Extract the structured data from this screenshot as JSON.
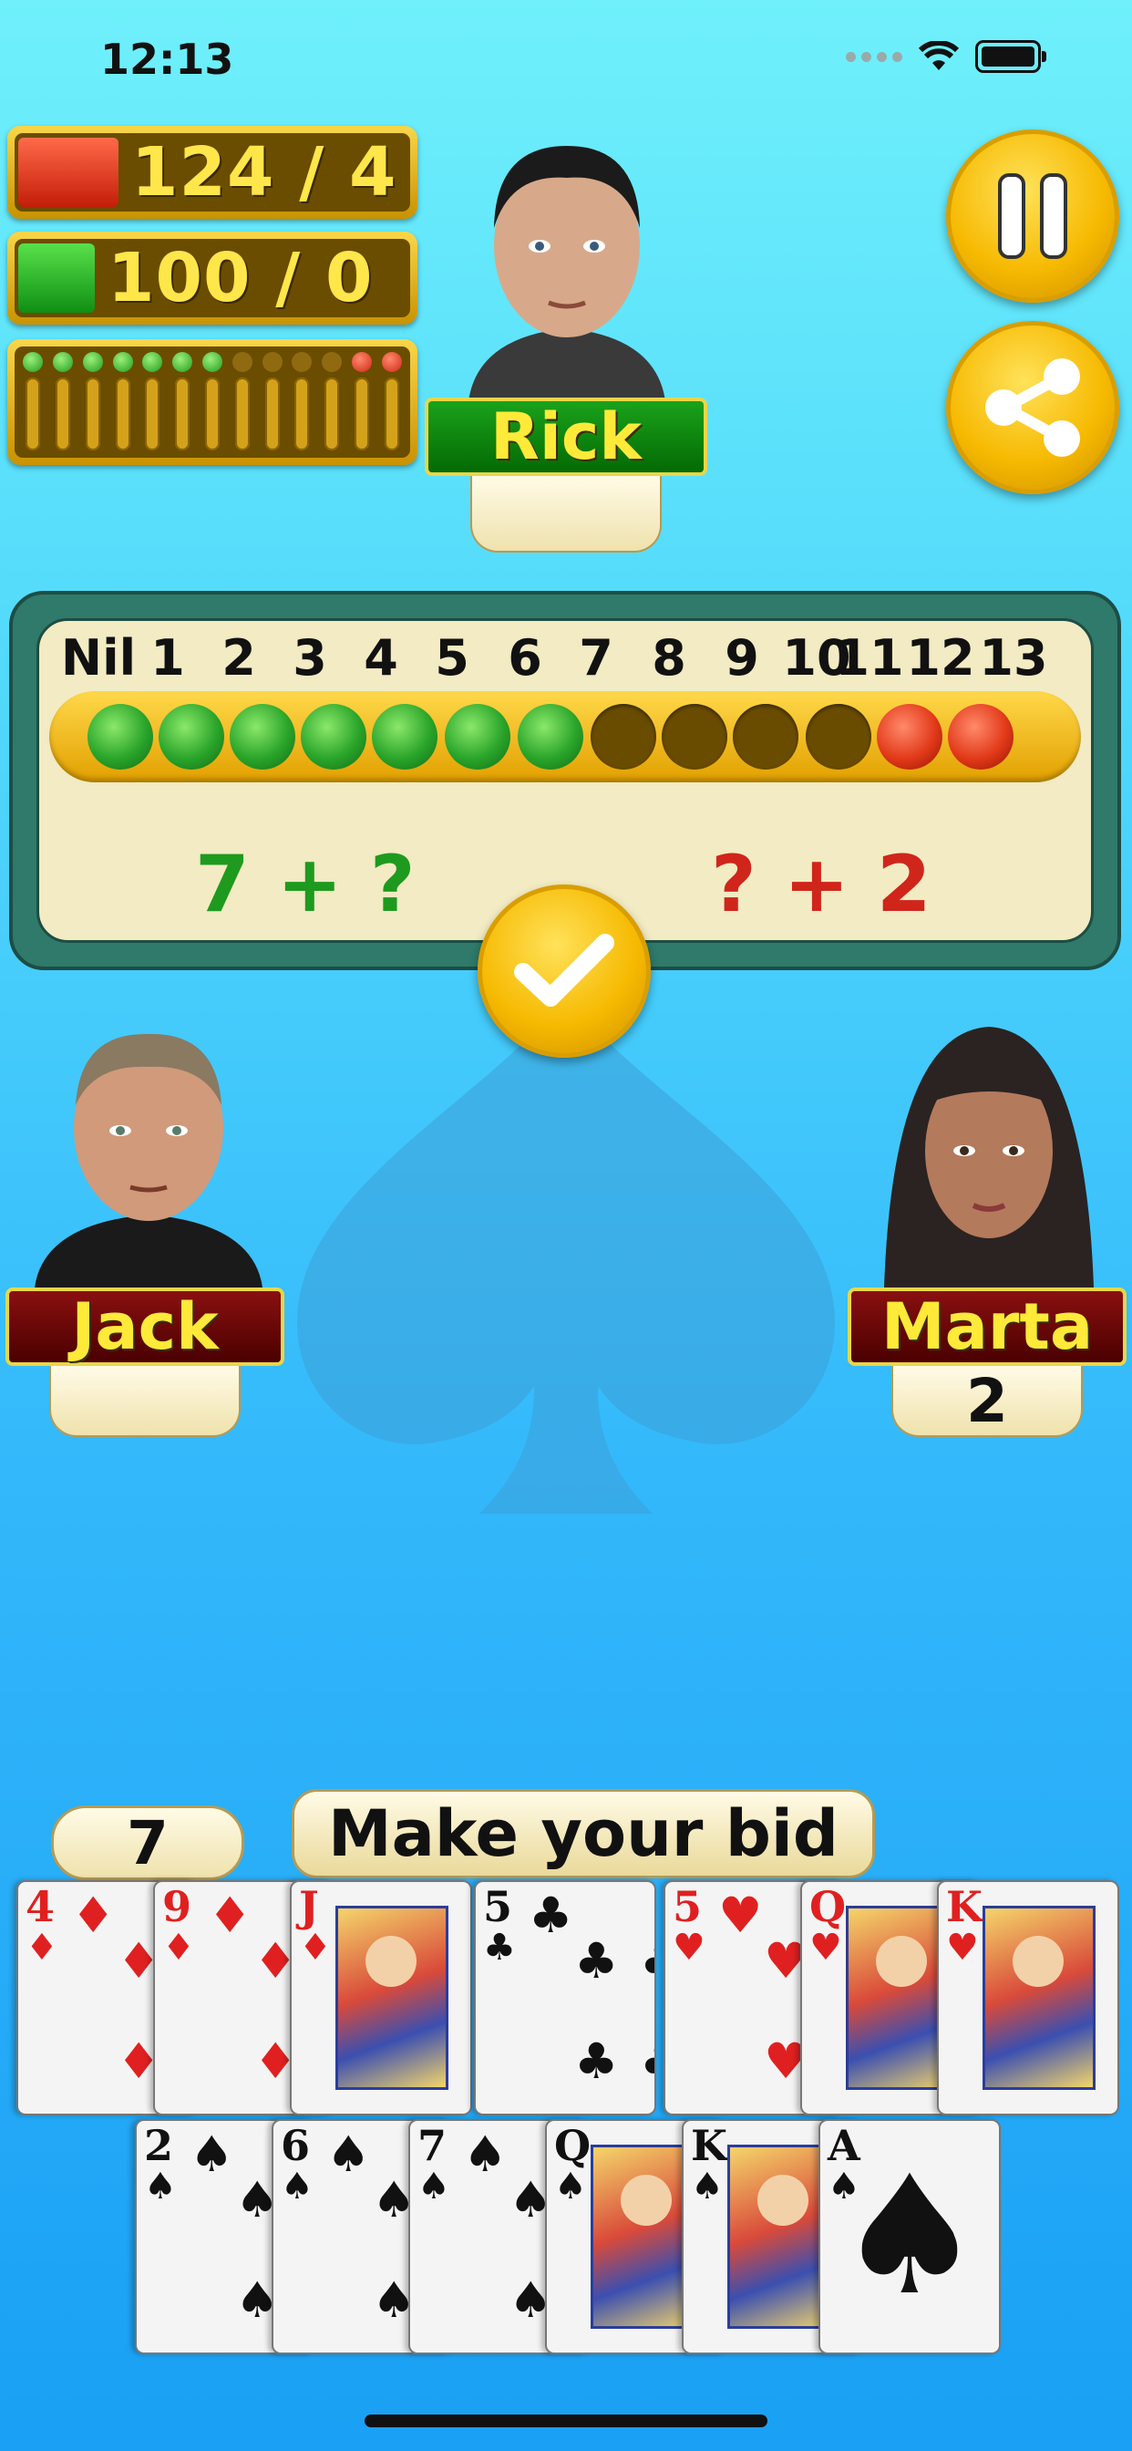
{
  "status_bar": {
    "time": "12:13"
  },
  "scores": {
    "red_team": {
      "text": "124 / 4",
      "color": "#e53a1e"
    },
    "green_team": {
      "text": "100 / 0",
      "color": "#22b21e"
    }
  },
  "tricks_indicator": [
    "green",
    "green",
    "green",
    "green",
    "green",
    "green",
    "green",
    "off",
    "off",
    "off",
    "off",
    "red",
    "red"
  ],
  "players": {
    "top": {
      "name": "Rick",
      "bid": ""
    },
    "left": {
      "name": "Jack",
      "bid": ""
    },
    "right": {
      "name": "Marta",
      "bid": "2"
    }
  },
  "bid_panel": {
    "numbers": [
      "Nil",
      "1",
      "2",
      "3",
      "4",
      "5",
      "6",
      "7",
      "8",
      "9",
      "10",
      "11",
      "12",
      "13"
    ],
    "dots": [
      "green",
      "green",
      "green",
      "green",
      "green",
      "green",
      "green",
      "empty",
      "empty",
      "empty",
      "empty",
      "red",
      "red"
    ],
    "team_green_bid": "7 + ?",
    "team_red_bid": "? + 2"
  },
  "buttons": {
    "pause": "pause-icon",
    "share": "share-icon",
    "confirm": "checkmark-icon"
  },
  "my_bid": "7",
  "prompt": "Make your bid",
  "hand": {
    "row1": [
      {
        "rank": "4",
        "suit": "♦",
        "color": "red"
      },
      {
        "rank": "9",
        "suit": "♦",
        "color": "red"
      },
      {
        "rank": "J",
        "suit": "♦",
        "color": "red",
        "face": true
      },
      {
        "rank": "5",
        "suit": "♣",
        "color": "black"
      },
      {
        "rank": "5",
        "suit": "♥",
        "color": "red"
      },
      {
        "rank": "Q",
        "suit": "♥",
        "color": "red",
        "face": true
      },
      {
        "rank": "K",
        "suit": "♥",
        "color": "red",
        "face": true
      }
    ],
    "row2": [
      {
        "rank": "2",
        "suit": "♠",
        "color": "black"
      },
      {
        "rank": "6",
        "suit": "♠",
        "color": "black"
      },
      {
        "rank": "7",
        "suit": "♠",
        "color": "black"
      },
      {
        "rank": "Q",
        "suit": "♠",
        "color": "black",
        "face": true
      },
      {
        "rank": "K",
        "suit": "♠",
        "color": "black",
        "face": true
      },
      {
        "rank": "A",
        "suit": "♠",
        "color": "black",
        "ace": true
      }
    ]
  }
}
